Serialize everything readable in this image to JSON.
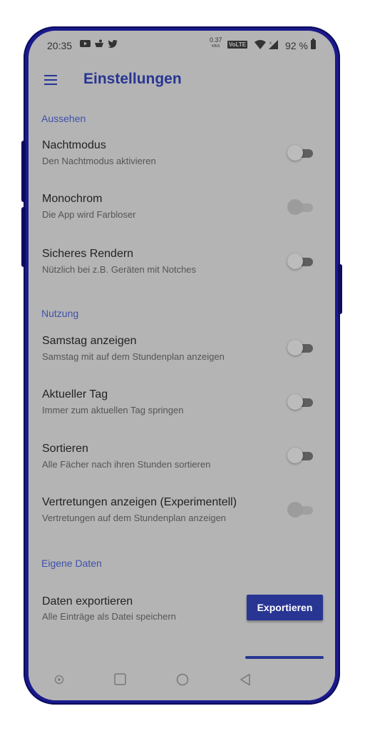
{
  "statusbar": {
    "time": "20:35",
    "notif_icons": [
      "youtube-icon",
      "pot-icon",
      "twitter-icon"
    ],
    "speed_value": "0.37",
    "speed_unit": "KB/S",
    "network_badge": "VoLTE",
    "battery_percent": "92 %"
  },
  "appbar": {
    "title": "Einstellungen"
  },
  "sections": {
    "appearance": {
      "header": "Aussehen",
      "items": [
        {
          "title": "Nachtmodus",
          "subtitle": "Den Nachtmodus aktivieren",
          "enabled": false
        },
        {
          "title": "Monochrom",
          "subtitle": "Die App wird Farbloser",
          "enabled": false
        },
        {
          "title": "Sicheres Rendern",
          "subtitle": "Nützlich bei z.B. Geräten mit Notches",
          "enabled": false
        }
      ]
    },
    "usage": {
      "header": "Nutzung",
      "items": [
        {
          "title": "Samstag anzeigen",
          "subtitle": "Samstag mit auf dem Stundenplan anzeigen",
          "enabled": false
        },
        {
          "title": "Aktueller Tag",
          "subtitle": "Immer zum aktuellen Tag springen",
          "enabled": false
        },
        {
          "title": "Sortieren",
          "subtitle": "Alle Fächer nach ihren Stunden sortieren",
          "enabled": false
        },
        {
          "title": "Vertretungen anzeigen (Experimentell)",
          "subtitle": "Vertretungen auf dem Stundenplan anzeigen",
          "enabled": false
        }
      ]
    },
    "own_data": {
      "header": "Eigene Daten",
      "items": [
        {
          "title": "Daten exportieren",
          "subtitle": "Alle Einträge als Datei speichern",
          "button": "Exportieren"
        }
      ]
    }
  },
  "colors": {
    "accent": "#283593",
    "screen_bg": "#b4b4b4",
    "frame": "#1a1a8c"
  }
}
